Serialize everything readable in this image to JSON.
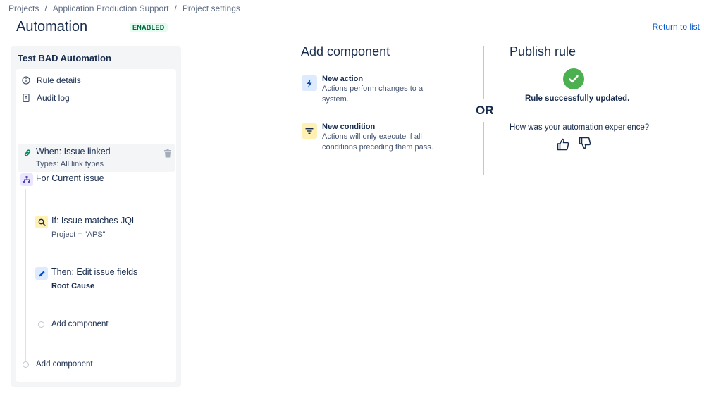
{
  "breadcrumb": {
    "items": [
      "Projects",
      "Application Production Support",
      "Project settings"
    ],
    "separator": "/"
  },
  "header": {
    "title": "Automation",
    "status_badge": "ENABLED",
    "return_link": "Return to list"
  },
  "rule": {
    "name": "Test BAD Automation",
    "menu": {
      "rule_details": "Rule details",
      "audit_log": "Audit log"
    },
    "trigger": {
      "title": "When: Issue linked",
      "subtitle": "Types: All link types"
    },
    "branch": {
      "title": "For Current issue"
    },
    "condition": {
      "title": "If: Issue matches JQL",
      "subtitle": "Project = \"APS\""
    },
    "action": {
      "title": "Then: Edit issue fields",
      "subtitle": "Root Cause"
    },
    "add_component_inner": "Add component",
    "add_component_outer": "Add component"
  },
  "add_component": {
    "title": "Add component",
    "new_action": {
      "title": "New action",
      "description": "Actions perform changes to a system."
    },
    "new_condition": {
      "title": "New condition",
      "description": "Actions will only execute if all conditions preceding them pass."
    }
  },
  "or_label": "OR",
  "publish": {
    "title": "Publish rule",
    "success_message": "Rule successfully updated.",
    "feedback_question": "How was your automation experience?"
  },
  "colors": {
    "link": "#0052cc",
    "success": "#4caf50",
    "badge_text": "#006644",
    "badge_bg": "#e3fcef",
    "action_icon_bg": "#deebff",
    "condition_icon_bg": "#fff0b3",
    "branch_icon_bg": "#eae6ff",
    "trigger_icon_color": "#00875a"
  },
  "icons": {
    "rule_details": "info-icon",
    "audit_log": "document-icon",
    "trigger": "link-icon",
    "delete": "trash-icon",
    "branch": "hierarchy-icon",
    "condition": "search-icon",
    "action": "pencil-icon",
    "new_action": "lightning-icon",
    "new_condition": "filter-icon",
    "success": "checkmark-icon",
    "thumbs_up": "thumbs-up-icon",
    "thumbs_down": "thumbs-down-icon"
  }
}
